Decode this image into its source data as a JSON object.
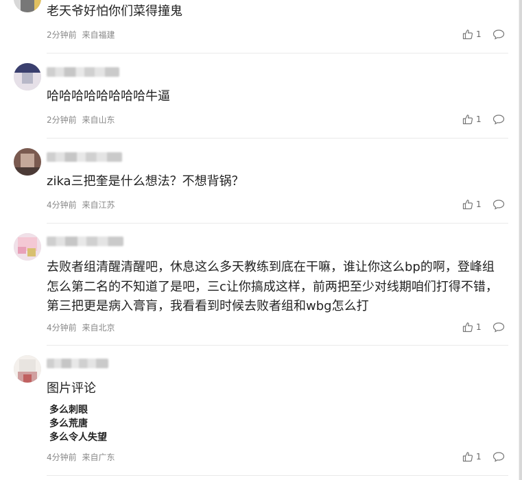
{
  "comments": [
    {
      "content": "老天爷好怕你们菜得撞鬼",
      "time": "2分钟前",
      "location": "来自福建",
      "likes": "1",
      "avatar_colors": [
        "#e0c060",
        "#777777",
        "#d8d8d8",
        "#b09060"
      ]
    },
    {
      "content": "哈哈哈哈哈哈哈哈牛逼",
      "time": "2分钟前",
      "location": "来自山东",
      "likes": "1",
      "avatar_colors": [
        "#3a3f6e",
        "#b8b8c8",
        "#e6e0e8",
        "#7c5c7c"
      ]
    },
    {
      "content": "zika三把奎是什么想法？不想背锅？",
      "time": "4分钟前",
      "location": "来自江苏",
      "likes": "1",
      "avatar_colors": [
        "#7a5a50",
        "#c4a89a",
        "#4b3a36",
        "#e6d8d0"
      ]
    },
    {
      "content": "去败者组清醒清醒吧，休息这么多天教练到底在干嘛，谁让你这么bp的啊，登峰组怎么第二名的不知道了是吧，三c让你搞成这样，前两把至少对线期咱们打得不错，第三把更是病入膏肓，我看看到时候去败者组和wbg怎么打",
      "time": "4分钟前",
      "location": "来自北京",
      "likes": "1",
      "avatar_colors": [
        "#f4c8d4",
        "#e8a0b8",
        "#f0e0e8",
        "#d8c070"
      ]
    },
    {
      "content": "图片评论",
      "sub_lines": [
        "多么刺眼",
        "多么荒唐",
        "多么令人失望"
      ],
      "time": "4分钟前",
      "location": "来自广东",
      "likes": "1",
      "avatar_colors": [
        "#e8e4e0",
        "#d0a0a0",
        "#c06060",
        "#f4f0ec"
      ]
    }
  ],
  "icons": {
    "like": "thumbs-up-icon",
    "reply": "comment-bubble-icon"
  }
}
